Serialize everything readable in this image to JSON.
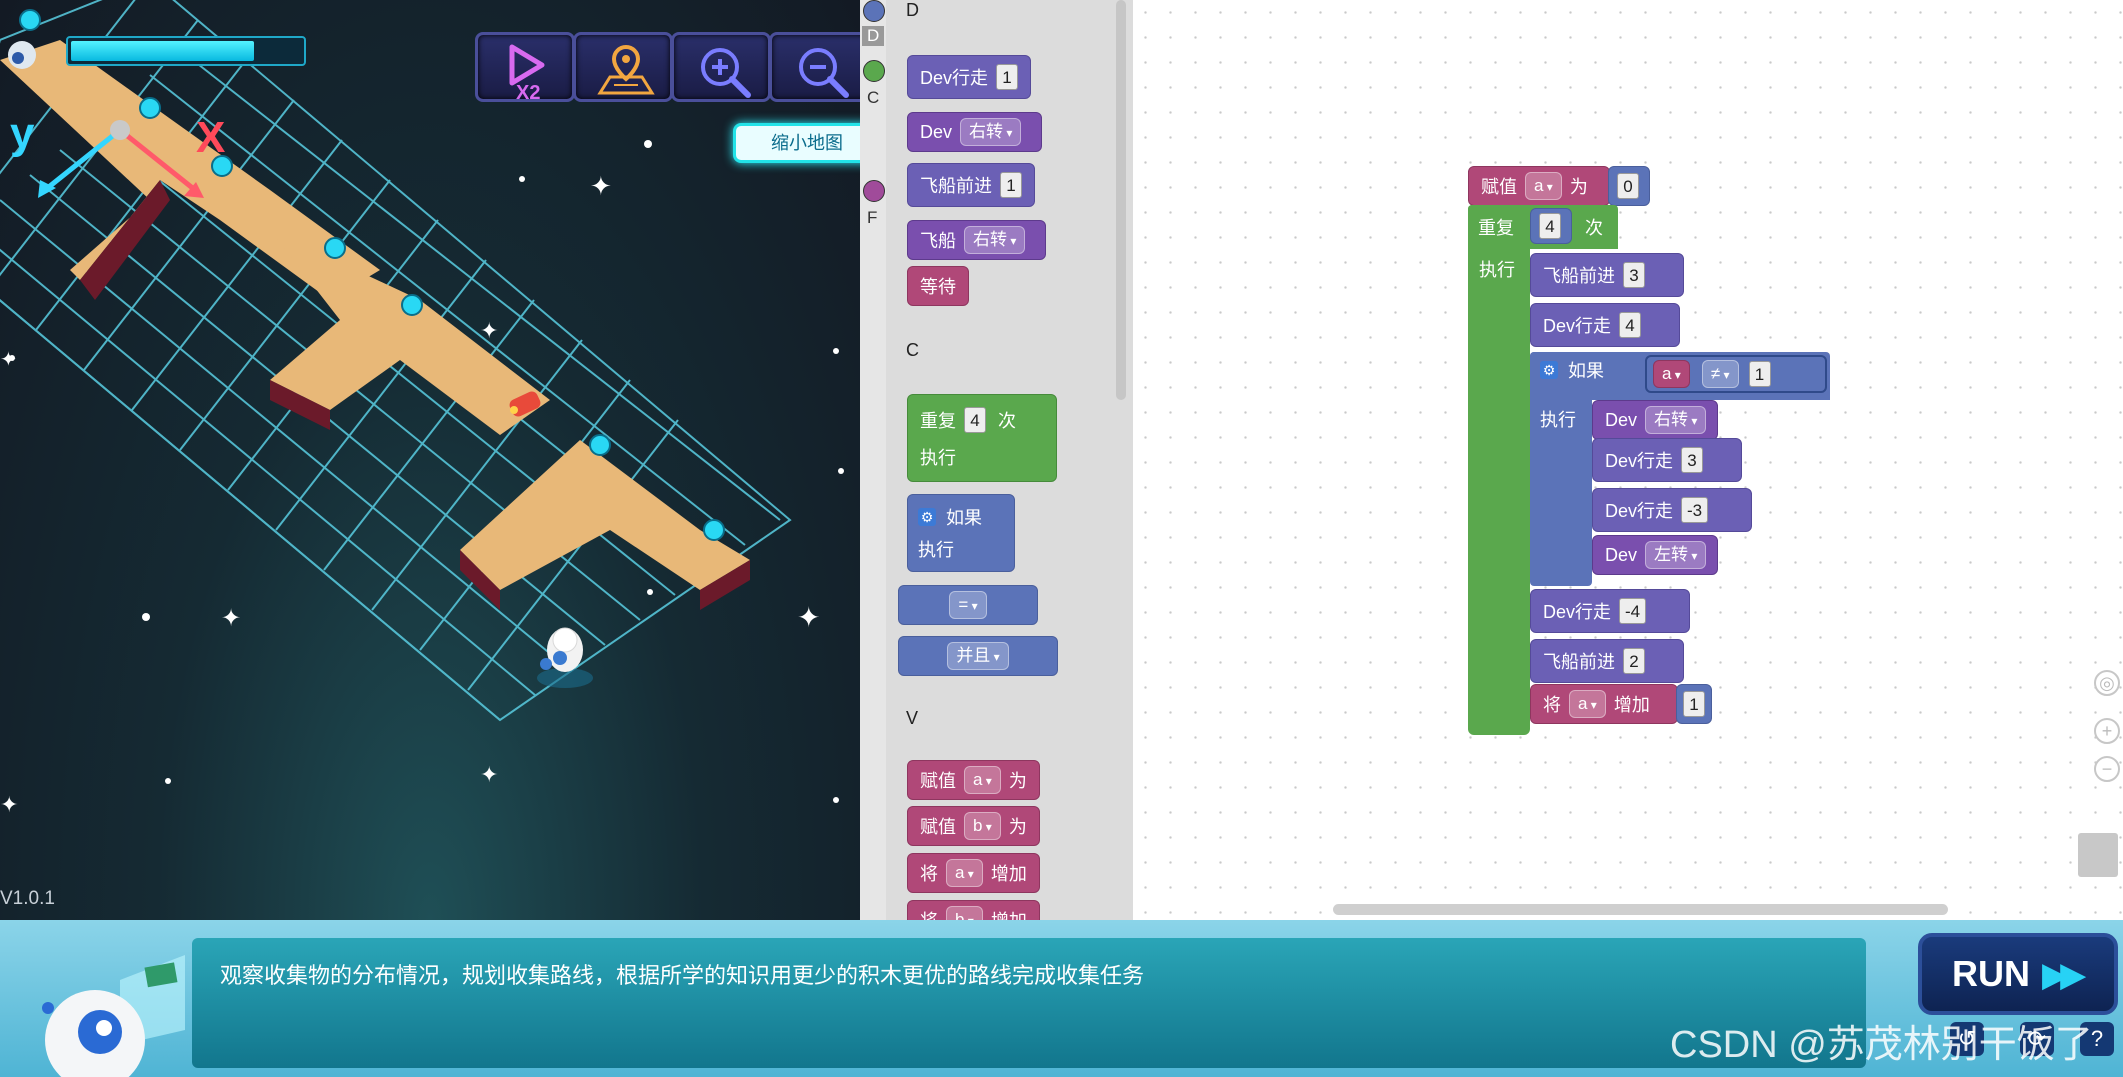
{
  "game": {
    "version": "V1.0.1",
    "axis_x": "X",
    "axis_y": "y",
    "progress": 0.8,
    "tools": [
      {
        "name": "speed-x2",
        "label": "X2"
      },
      {
        "name": "map",
        "label": ""
      },
      {
        "name": "zoom-in",
        "label": ""
      },
      {
        "name": "zoom-out",
        "label": ""
      }
    ],
    "tooltip": "缩小地图"
  },
  "toolbox": {
    "categories": [
      "D",
      "C",
      "F"
    ],
    "sections": {
      "d_header": "D",
      "c_header": "C",
      "v_header": "V"
    },
    "d_blocks": {
      "dev_walk": "Dev行走",
      "dev_walk_val": "1",
      "dev": "Dev",
      "dev_turn": "右转",
      "ship_forward": "飞船前进",
      "ship_forward_val": "1",
      "ship": "飞船",
      "ship_turn": "右转",
      "wait": "等待"
    },
    "c_blocks": {
      "repeat": "重复",
      "repeat_val": "4",
      "times": "次",
      "do": "执行",
      "if": "如果",
      "if_do": "执行",
      "compare_op": "=",
      "logic_op": "并且"
    },
    "v_blocks": {
      "assign": "赋值",
      "var_a": "a",
      "var_b": "b",
      "to": "为",
      "change": "将",
      "increase": "增加"
    }
  },
  "workspace": {
    "assign": "赋值",
    "var": "a",
    "to": "为",
    "init_val": "0",
    "repeat": "重复",
    "repeat_val": "4",
    "times": "次",
    "do": "执行",
    "ship_forward_1": "飞船前进",
    "ship_forward_1_val": "3",
    "dev_walk_1": "Dev行走",
    "dev_walk_1_val": "4",
    "if": "如果",
    "if_var": "a",
    "if_op": "≠",
    "if_val": "1",
    "if_do": "执行",
    "dev_a": "Dev",
    "turn_right": "右转",
    "dev_walk_2": "Dev行走",
    "dev_walk_2_val": "3",
    "dev_walk_3": "Dev行走",
    "dev_walk_3_val": "-3",
    "dev_b": "Dev",
    "turn_left": "左转",
    "dev_walk_4": "Dev行走",
    "dev_walk_4_val": "-4",
    "ship_forward_2": "飞船前进",
    "ship_forward_2_val": "2",
    "change": "将",
    "change_var": "a",
    "increase": "增加",
    "change_val": "1"
  },
  "bottom": {
    "task_text": "观察收集物的分布情况，规划收集路线，根据所学的知识用更少的积木更优的路线完成收集任务",
    "run_label": "RUN",
    "watermark": "CSDN @苏茂林别干饭了"
  }
}
